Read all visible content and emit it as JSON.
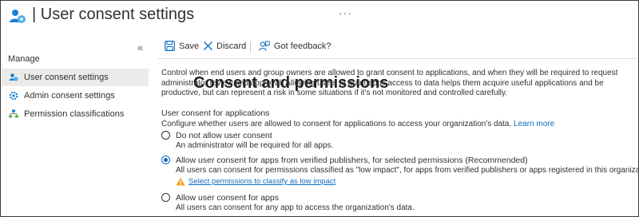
{
  "header": {
    "title_main": "Consent and permissions",
    "title_separator": " | ",
    "title_sub": "User consent settings",
    "more_label": "···",
    "app_icon": "consent-permissions-icon"
  },
  "sidebar": {
    "collapse_label": "«",
    "section_heading": "Manage",
    "items": [
      {
        "label": "User consent settings",
        "icon": "user-consent-icon",
        "active": true
      },
      {
        "label": "Admin consent settings",
        "icon": "gear-icon",
        "active": false
      },
      {
        "label": "Permission classifications",
        "icon": "hierarchy-icon",
        "active": false
      }
    ]
  },
  "toolbar": {
    "save_label": "Save",
    "discard_label": "Discard",
    "feedback_label": "Got feedback?"
  },
  "main": {
    "description": "Control when end users and group owners are allowed to grant consent to applications, and when they will be required to request administrator review and approval. Allowing users to grant apps access to data helps them acquire useful applications and be productive, but can represent a risk in some situations if it's not monitored and controlled carefully.",
    "section_title": "User consent for applications",
    "section_desc": "Configure whether users are allowed to consent for applications to access your organization's data.",
    "learn_more": "Learn more",
    "options": [
      {
        "label": "Do not allow user consent",
        "description": "An administrator will be required for all apps.",
        "checked": false
      },
      {
        "label": "Allow user consent for apps from verified publishers, for selected permissions (Recommended)",
        "description": "All users can consent for permissions classified as \"low impact\", for apps from verified publishers or apps registered in this organization.",
        "checked": true,
        "warning_link": "Select permissions to classify as low impact"
      },
      {
        "label": "Allow user consent for apps",
        "description": "All users can consent for any app to access the organization's data.",
        "checked": false
      }
    ]
  },
  "colors": {
    "accent": "#0f6cbd",
    "warning": "#f7a020",
    "active_bg": "#edebe9"
  }
}
